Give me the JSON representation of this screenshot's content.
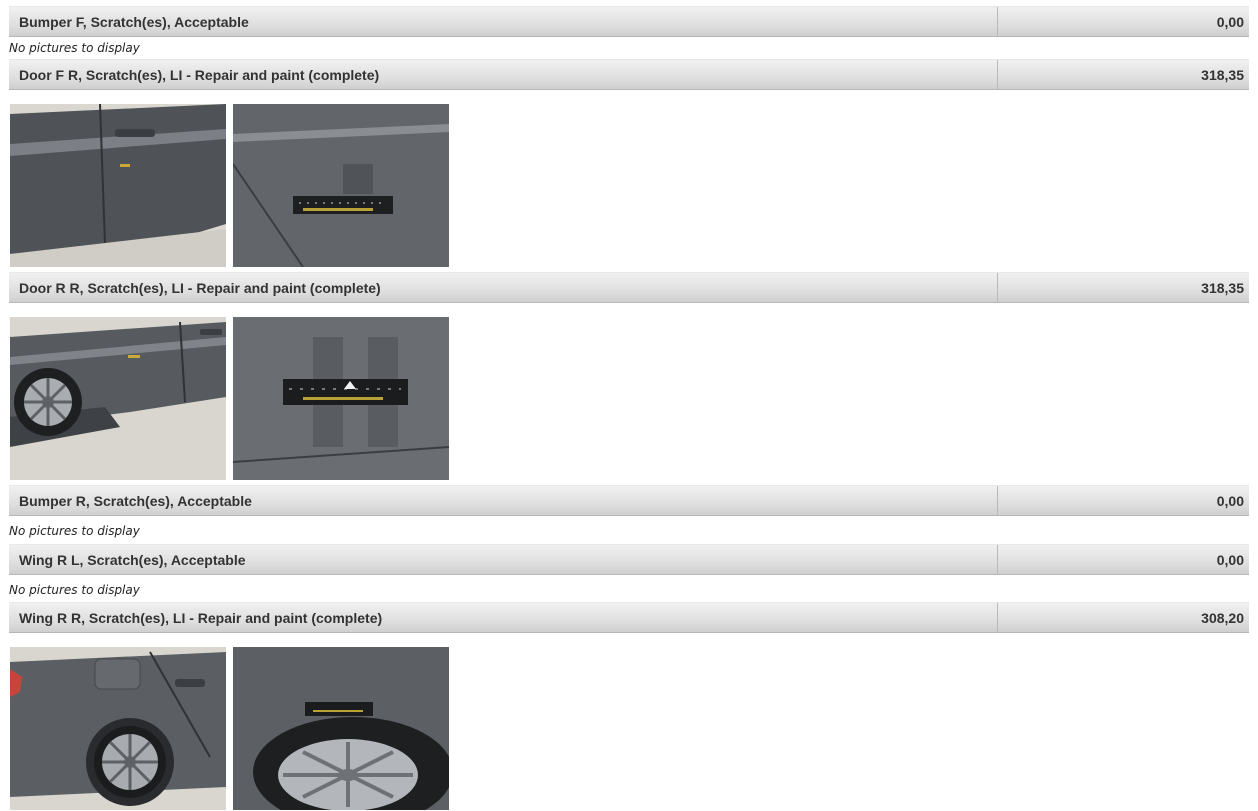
{
  "damage_items": [
    {
      "description": "Bumper F, Scratch(es), Acceptable",
      "price": "0,00",
      "no_pictures": "No pictures to display"
    },
    {
      "description": "Door F R, Scratch(es), LI - Repair and paint (complete)",
      "price": "318,35"
    },
    {
      "description": "Door R R, Scratch(es), LI - Repair and paint (complete)",
      "price": "318,35"
    },
    {
      "description": "Bumper R, Scratch(es), Acceptable",
      "price": "0,00",
      "no_pictures": "No pictures to display"
    },
    {
      "description": "Wing R L, Scratch(es), Acceptable",
      "price": "0,00",
      "no_pictures": "No pictures to display"
    },
    {
      "description": "Wing R R, Scratch(es), LI - Repair and paint (complete)",
      "price": "308,20"
    }
  ],
  "colors": {
    "bar_text": "#333333",
    "car_paint": "#5a5e63",
    "floor": "#d8d6cf"
  },
  "photo_icons": [
    "car-door-photo",
    "damage-closeup-photo",
    "car-wheel-photo"
  ]
}
